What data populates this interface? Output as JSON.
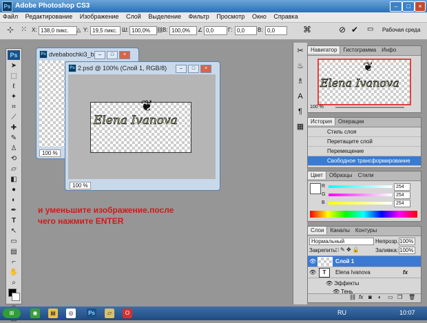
{
  "window": {
    "title": "Adobe Photoshop CS3",
    "logo": "Ps"
  },
  "menu": [
    "Файл",
    "Редактирование",
    "Изображение",
    "Слой",
    "Выделение",
    "Фильтр",
    "Просмотр",
    "Окно",
    "Справка"
  ],
  "options": {
    "x_label": "X:",
    "x_value": "138,0 пикс.",
    "y_label": "Y:",
    "y_value": "19,5 пикс.",
    "w_label": "Ш:",
    "w_value": "100,0%",
    "h_label": "В:",
    "h_value": "100,0%",
    "angle_value": "0,0",
    "hskew_label": "Г:",
    "hskew_value": "0,0",
    "vskew_label": "В:",
    "vskew_value": "0,0",
    "workspace": "Рабочая среда"
  },
  "doc_back": {
    "title": "dvebabochki3_b.p...",
    "zoom": "100 %"
  },
  "doc_front": {
    "title": "2.psd @ 100% (Слой 1, RGB/8)",
    "zoom": "100 %",
    "artwork_text": "Elena Ivanova"
  },
  "caption": {
    "line1": "и уменьшите изображение.после",
    "line2": "чего нажмите ENTER"
  },
  "navigator": {
    "tabs": [
      "Навигатор",
      "Гистограмма",
      "Инфо"
    ],
    "zoom": "100 %",
    "preview_text": "Elena Ivanova"
  },
  "history": {
    "tabs": [
      "История",
      "Операции"
    ],
    "items": [
      "Стиль слоя",
      "Перетащите слой",
      "Перемещение",
      "Свободное трансформирование"
    ],
    "selected_index": 3
  },
  "color": {
    "tabs": [
      "Цвет",
      "Образцы",
      "Стили"
    ],
    "channels": [
      {
        "label": "R",
        "value": "254"
      },
      {
        "label": "G",
        "value": "254"
      },
      {
        "label": "B",
        "value": "254"
      }
    ]
  },
  "layers": {
    "tabs": [
      "Слои",
      "Каналы",
      "Контуры"
    ],
    "blend_mode": "Нормальный",
    "opacity_label": "Непрозр.:",
    "opacity_value": "100%",
    "lock_label": "Закрепить:",
    "fill_label": "Заливка:",
    "fill_value": "100%",
    "rows": [
      {
        "name": "Слой 1",
        "type": "image",
        "selected": true
      },
      {
        "name": "Elena Ivanova",
        "type": "text",
        "fx": "fx"
      },
      {
        "name": "Эффекты",
        "type": "effects"
      },
      {
        "name": "Тень",
        "type": "effect"
      }
    ]
  },
  "taskbar": {
    "lang": "RU",
    "clock": "10:07"
  },
  "colors": {
    "accent": "#3a7ad3",
    "caption": "#d01a1a"
  }
}
